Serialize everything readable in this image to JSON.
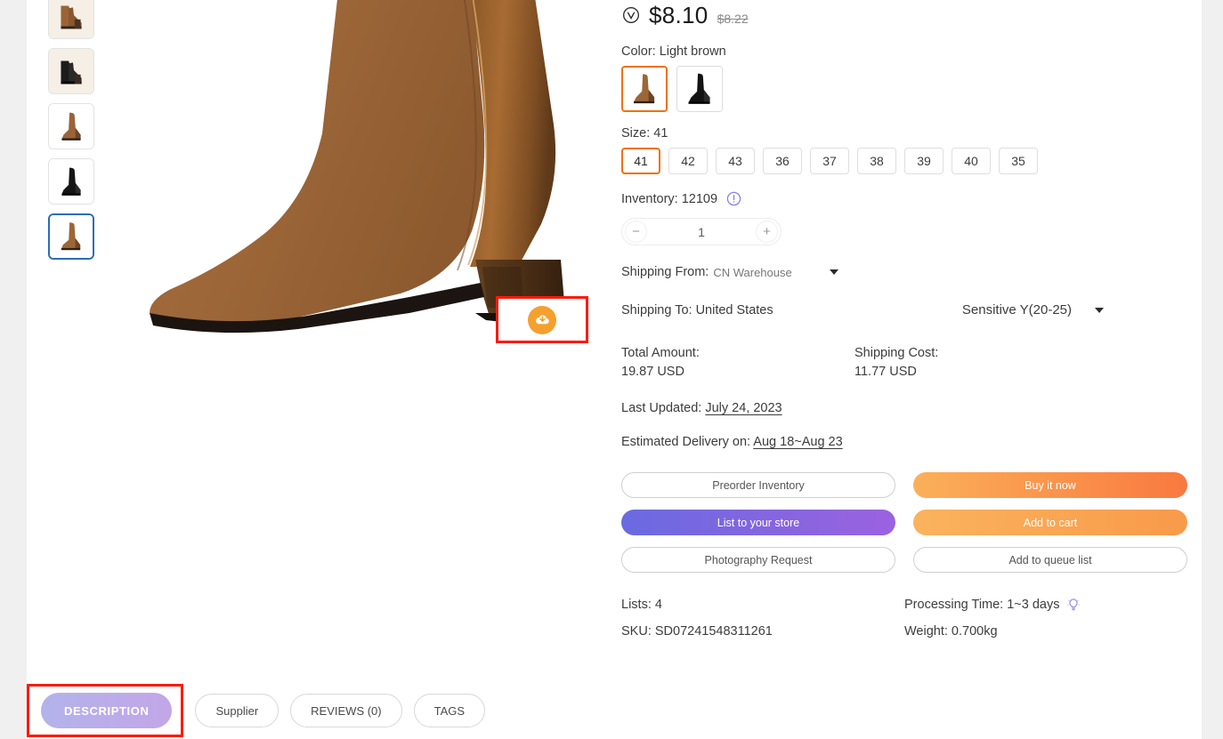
{
  "product": {
    "price_current": "$8.10",
    "price_original": "$8.22",
    "verified_badge": "verified-v-icon"
  },
  "color": {
    "label": "Color: Light brown",
    "options": [
      {
        "name": "Light brown",
        "selected": true
      },
      {
        "name": "Black",
        "selected": false
      }
    ]
  },
  "size": {
    "label": "Size: 41",
    "options": [
      "41",
      "42",
      "43",
      "36",
      "37",
      "38",
      "39",
      "40",
      "35"
    ],
    "selected": "41"
  },
  "inventory": {
    "label": "Inventory: 12109",
    "info_icon": "exclamation-circle-icon"
  },
  "quantity": {
    "value": "1",
    "minus": "−",
    "plus": "+"
  },
  "shipping": {
    "from_label": "Shipping From:",
    "from_value": "CN Warehouse",
    "to_label": "Shipping To: United States",
    "method": "Sensitive Y(20-25)"
  },
  "totals": {
    "total_label": "Total Amount:",
    "total_value": "19.87 USD",
    "shipping_label": "Shipping Cost:",
    "shipping_value": "11.77 USD"
  },
  "dates": {
    "last_updated_label": "Last Updated:",
    "last_updated_value": "July 24, 2023",
    "delivery_label": "Estimated Delivery on:",
    "delivery_value": "Aug 18~Aug 23"
  },
  "actions": {
    "preorder": "Preorder Inventory",
    "buy_now": "Buy it now",
    "list_store": "List to your store",
    "add_cart": "Add to cart",
    "photography": "Photography Request",
    "queue": "Add to queue list"
  },
  "meta": {
    "lists": "Lists: 4",
    "processing": "Processing Time: 1~3 days",
    "sku": "SKU: SD07241548311261",
    "weight": "Weight: 0.700kg",
    "bulb_icon": "lightbulb-icon"
  },
  "gallery": {
    "download_icon": "cloud-download-icon",
    "thumbnails": [
      {
        "alt": "pair-light-brown",
        "selected": false
      },
      {
        "alt": "pair-black",
        "selected": false
      },
      {
        "alt": "single-light-brown",
        "selected": false
      },
      {
        "alt": "single-black",
        "selected": false
      },
      {
        "alt": "single-light-brown-2",
        "selected": true
      }
    ]
  },
  "tabs": [
    {
      "label": "DESCRIPTION",
      "active": true
    },
    {
      "label": "Supplier",
      "active": false
    },
    {
      "label": "REVIEWS (0)",
      "active": false
    },
    {
      "label": "TAGS",
      "active": false
    }
  ],
  "colors": {
    "accent_orange": "#ef7110",
    "highlight_red": "#fd1a0c",
    "purple": "#8a6ae0",
    "cta_orange": "#f9873f",
    "thumb_selected_blue": "#2a6eb5"
  }
}
